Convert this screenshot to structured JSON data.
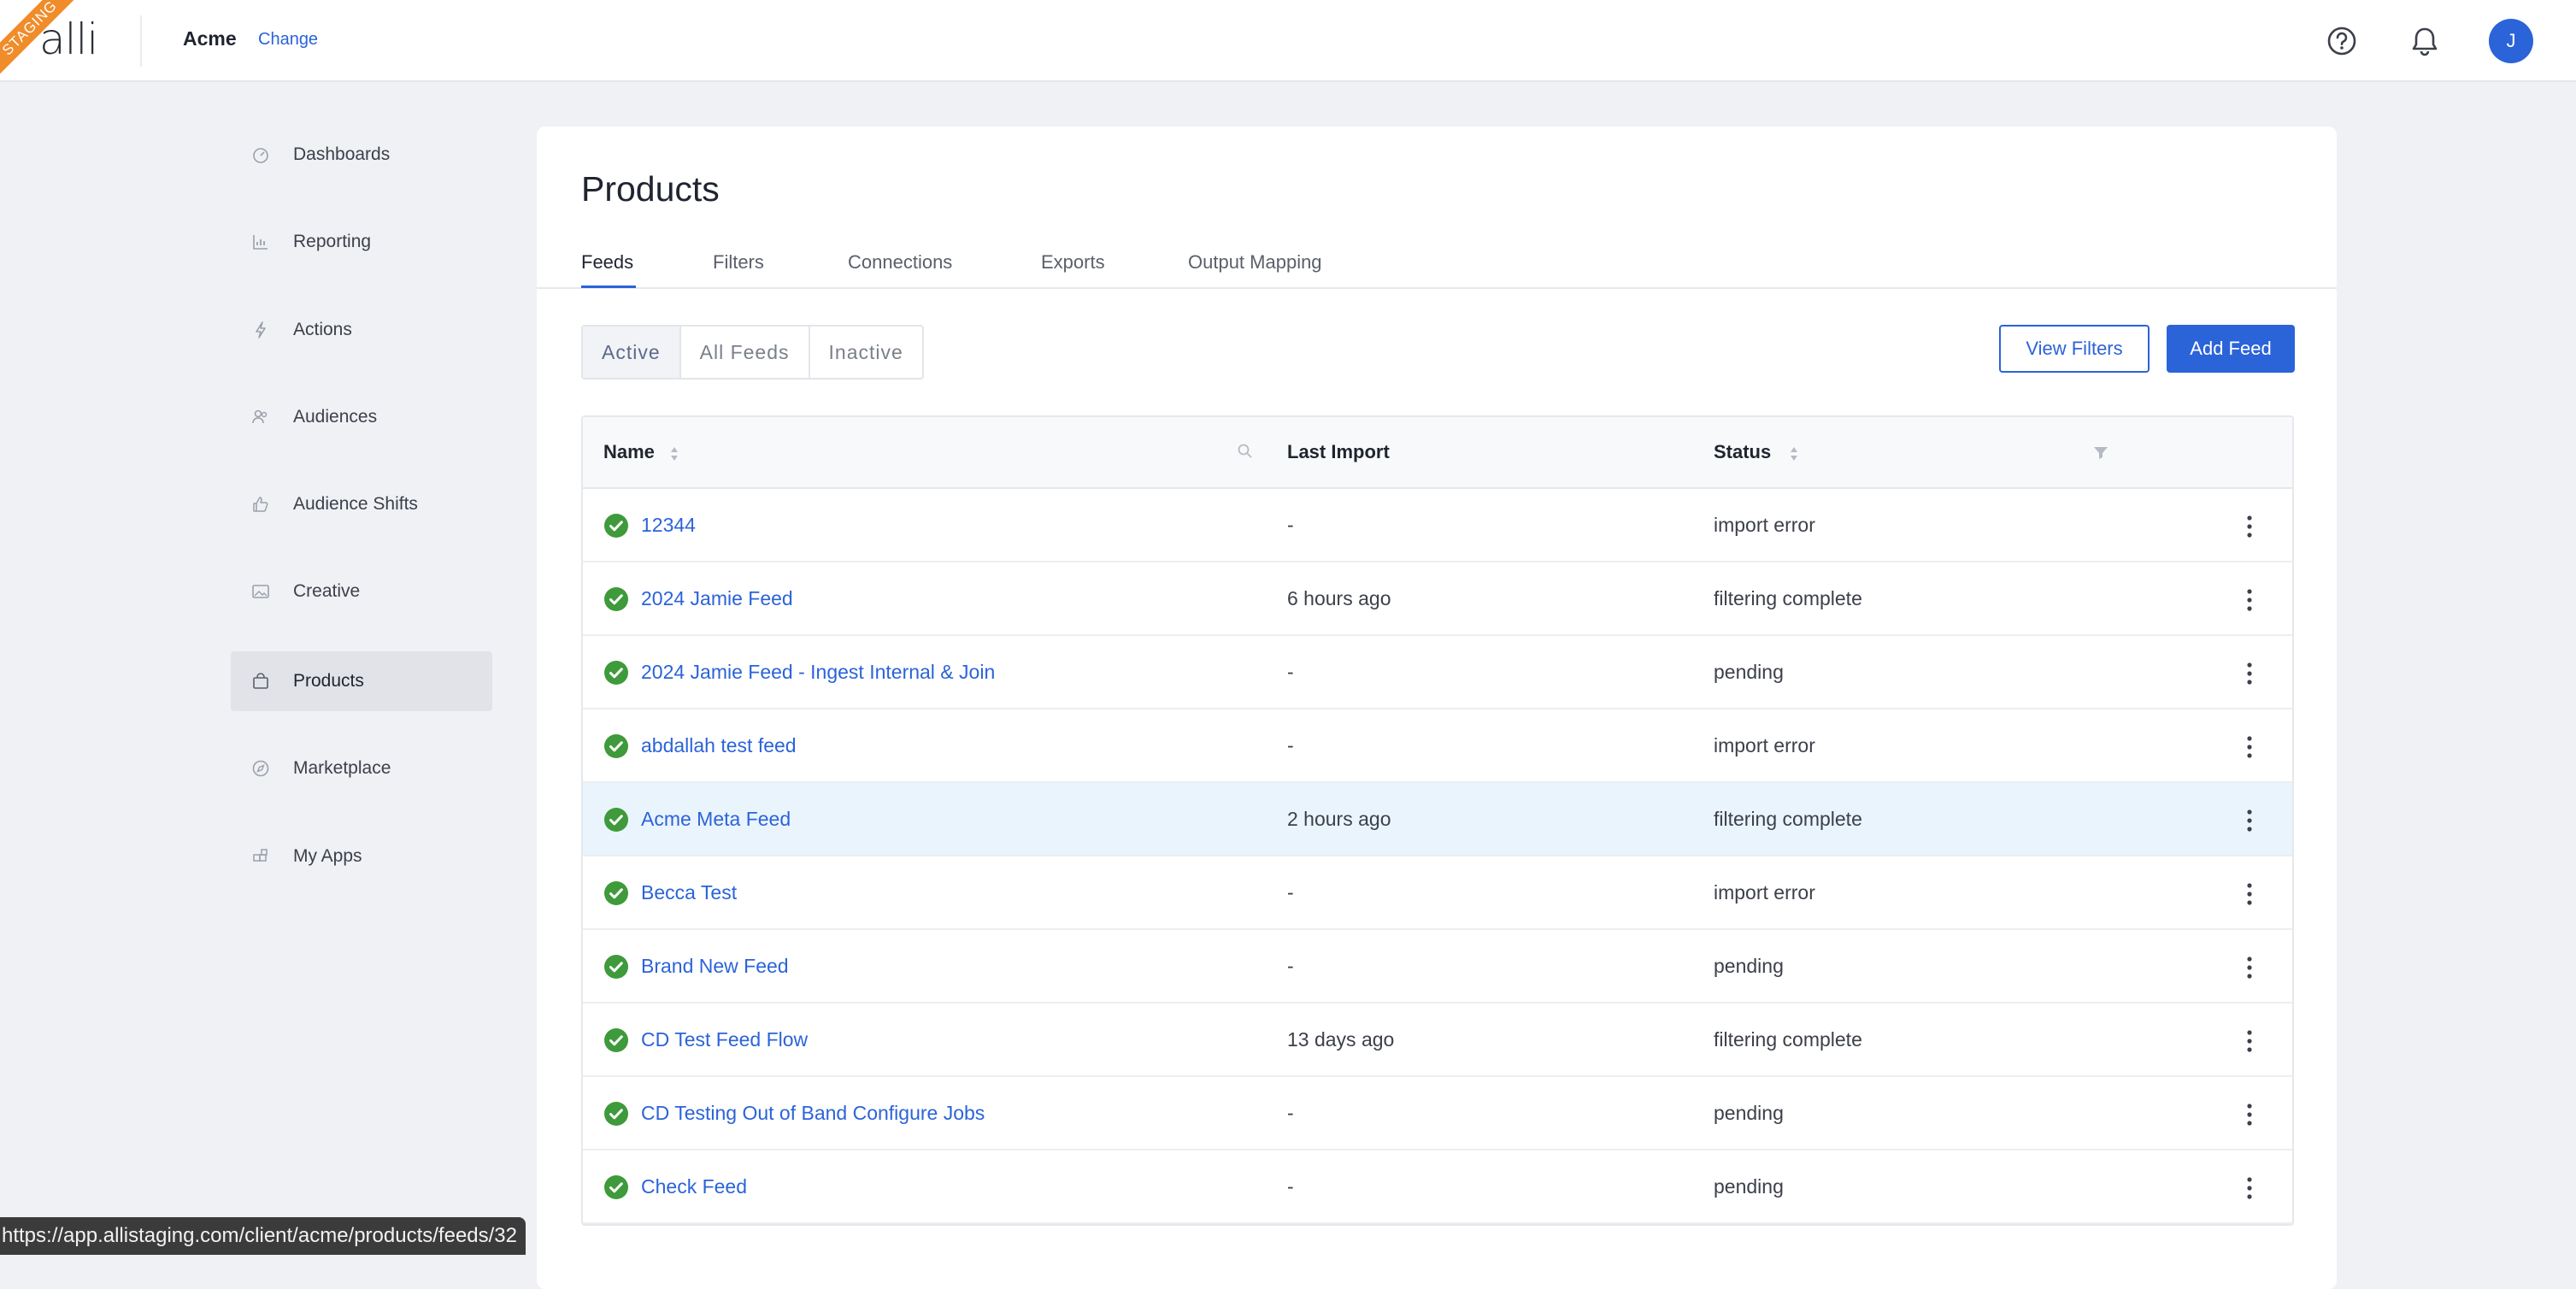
{
  "env_badge": "STAGING",
  "logo_text": "alli",
  "org": {
    "name": "Acme",
    "change_label": "Change"
  },
  "header_icons": {
    "help": "help-circle-icon",
    "notifications": "bell-icon"
  },
  "user": {
    "initial": "J",
    "avatar_color": "#2b63d9"
  },
  "sidebar": {
    "items": [
      {
        "label": "Dashboards",
        "icon": "gauge-icon",
        "active": false
      },
      {
        "label": "Reporting",
        "icon": "bar-chart-icon",
        "active": false
      },
      {
        "label": "Actions",
        "icon": "lightning-icon",
        "active": false
      },
      {
        "label": "Audiences",
        "icon": "people-icon",
        "active": false
      },
      {
        "label": "Audience Shifts",
        "icon": "thumbs-up-icon",
        "active": false
      },
      {
        "label": "Creative",
        "icon": "image-icon",
        "active": false
      },
      {
        "label": "Products",
        "icon": "shopping-bag-icon",
        "active": true
      },
      {
        "label": "Marketplace",
        "icon": "compass-icon",
        "active": false
      },
      {
        "label": "My Apps",
        "icon": "apps-icon",
        "active": false
      }
    ]
  },
  "main": {
    "title": "Products",
    "tabs": [
      {
        "label": "Feeds",
        "active": true
      },
      {
        "label": "Filters",
        "active": false
      },
      {
        "label": "Connections",
        "active": false
      },
      {
        "label": "Exports",
        "active": false
      },
      {
        "label": "Output Mapping",
        "active": false
      }
    ],
    "segments": [
      {
        "label": "Active",
        "active": true
      },
      {
        "label": "All Feeds",
        "active": false
      },
      {
        "label": "Inactive",
        "active": false
      }
    ],
    "view_filters_label": "View Filters",
    "add_feed_label": "Add Feed"
  },
  "table": {
    "columns": {
      "name": "Name",
      "last_import": "Last Import",
      "status": "Status"
    },
    "rows": [
      {
        "name": "12344",
        "last_import": "-",
        "status": "import error"
      },
      {
        "name": "2024 Jamie Feed",
        "last_import": "6 hours ago",
        "status": "filtering complete"
      },
      {
        "name": "2024 Jamie Feed - Ingest Internal & Join",
        "last_import": "-",
        "status": "pending"
      },
      {
        "name": "abdallah test feed",
        "last_import": "-",
        "status": "import error"
      },
      {
        "name": "Acme Meta Feed",
        "last_import": "2 hours ago",
        "status": "filtering complete",
        "highlighted": true
      },
      {
        "name": "Becca Test",
        "last_import": "-",
        "status": "import error"
      },
      {
        "name": "Brand New Feed",
        "last_import": "-",
        "status": "pending"
      },
      {
        "name": "CD Test Feed Flow",
        "last_import": "13 days ago",
        "status": "filtering complete"
      },
      {
        "name": "CD Testing Out of Band Configure Jobs",
        "last_import": "-",
        "status": "pending"
      },
      {
        "name": "Check Feed",
        "last_import": "-",
        "status": "pending"
      }
    ]
  },
  "status_url": "https://app.allistaging.com/client/acme/products/feeds/32",
  "colors": {
    "accent": "#2b63d9",
    "success": "#3e9a3a",
    "ribbon": "#f08c2a"
  }
}
